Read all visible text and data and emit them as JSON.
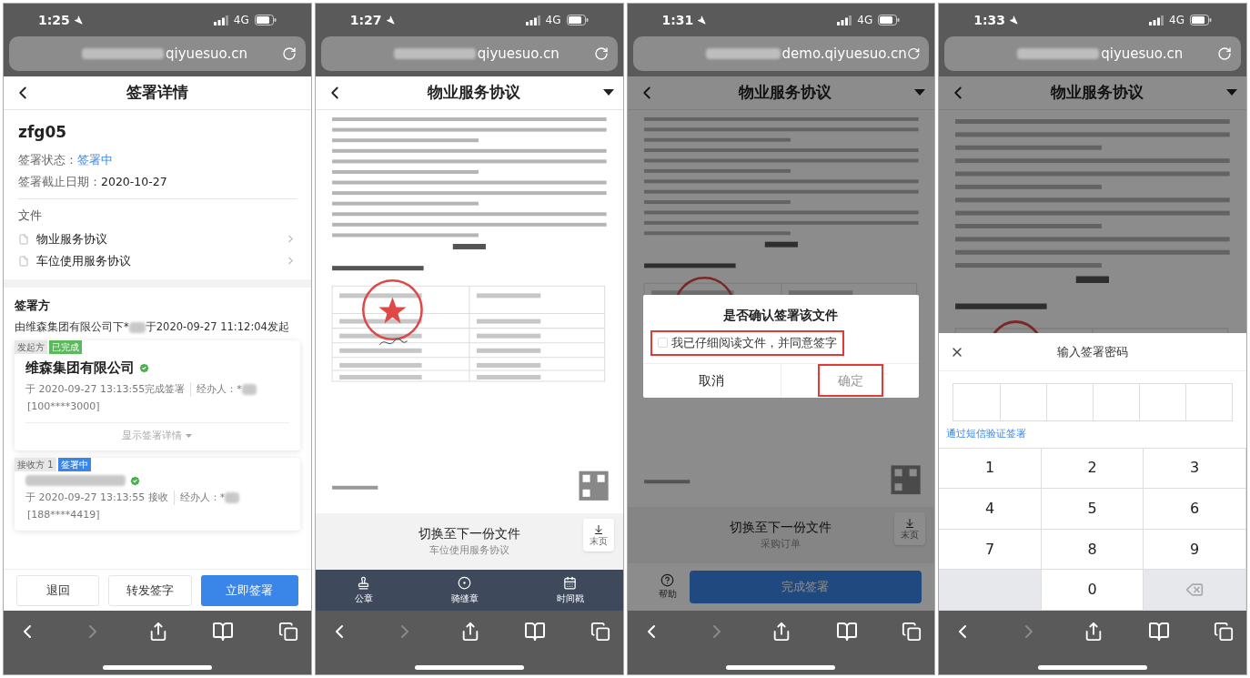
{
  "phones": [
    {
      "kind": "detail",
      "status_bar": {
        "time": "1:25",
        "network": "4G"
      },
      "url": "qiyuesuo.cn",
      "header": {
        "title": "签署详情",
        "dropdown": false
      },
      "contract": {
        "name": "zfg05",
        "fields": [
          {
            "label": "签署状态：",
            "value": "签署中",
            "highlight": true
          },
          {
            "label": "签署截止日期：",
            "value": "2020-10-27",
            "highlight": false
          }
        ]
      },
      "files": {
        "heading": "文件",
        "items": [
          "物业服务协议",
          "车位使用服务协议"
        ]
      },
      "signers": {
        "heading": "签署方",
        "initiated_before": "由维森集团有限公司下*",
        "initiated_after": "于2020-09-27 11:12:04发起",
        "items": [
          {
            "role": "发起方",
            "status": "已完成",
            "color": "#5cb85c",
            "name": "维森集团有限公司",
            "verified": true,
            "event": "于 2020-09-27 13:13:55完成签署",
            "agent": "经办人：*",
            "contact": "[100****3000]",
            "details": "显示签署详情"
          },
          {
            "role": "接收方 1",
            "status": "签署中",
            "color": "#3a86e8",
            "verified": true,
            "event": "于 2020-09-27 13:13:55 接收",
            "agent": "经办人：*",
            "contact": "[188****4419]"
          }
        ]
      },
      "actions": [
        {
          "label": "退回",
          "primary": false
        },
        {
          "label": "转发签字",
          "primary": false
        },
        {
          "label": "立即签署",
          "primary": true
        }
      ]
    },
    {
      "kind": "document",
      "status_bar": {
        "time": "1:27",
        "network": "4G"
      },
      "url": "qiyuesuo.cn",
      "header": {
        "title": "物业服务协议",
        "dropdown": true
      },
      "next_file": {
        "title": "切换至下一份文件",
        "name": "车位使用服务协议",
        "last_page": "末页"
      },
      "tools": [
        {
          "kind": "seal",
          "label": "公章"
        },
        {
          "kind": "riding-seal",
          "label": "骑缝章"
        },
        {
          "kind": "timestamp",
          "label": "时间戳"
        }
      ]
    },
    {
      "kind": "confirm",
      "status_bar": {
        "time": "1:31",
        "network": "4G"
      },
      "url": "demo.qiyuesuo.cn",
      "header": {
        "title": "物业服务协议",
        "dropdown": true
      },
      "next_file": {
        "title": "切换至下一份文件",
        "name": "采购订单",
        "last_page": "末页"
      },
      "footer": {
        "help": "帮助",
        "submit": "完成签署"
      },
      "dialog": {
        "title": "是否确认签署该文件",
        "checkbox": {
          "label": "我已仔细阅读文件，并同意签字",
          "checked": false,
          "annotated": true
        },
        "cancel": "取消",
        "confirm": {
          "label": "确定",
          "disabled": true,
          "annotated": true
        }
      }
    },
    {
      "kind": "password",
      "status_bar": {
        "time": "1:33",
        "network": "4G"
      },
      "url": "qiyuesuo.cn",
      "header": {
        "title": "物业服务协议",
        "dropdown": true
      },
      "sheet": {
        "title": "输入签署密码",
        "sms_link": "通过短信验证签署",
        "keys": [
          {
            "kind": "digit",
            "label": "1"
          },
          {
            "kind": "digit",
            "label": "2"
          },
          {
            "kind": "digit",
            "label": "3"
          },
          {
            "kind": "digit",
            "label": "4"
          },
          {
            "kind": "digit",
            "label": "5"
          },
          {
            "kind": "digit",
            "label": "6"
          },
          {
            "kind": "digit",
            "label": "7"
          },
          {
            "kind": "digit",
            "label": "8"
          },
          {
            "kind": "digit",
            "label": "9"
          },
          {
            "kind": "blank"
          },
          {
            "kind": "digit",
            "label": "0"
          },
          {
            "kind": "backspace"
          }
        ]
      }
    }
  ]
}
